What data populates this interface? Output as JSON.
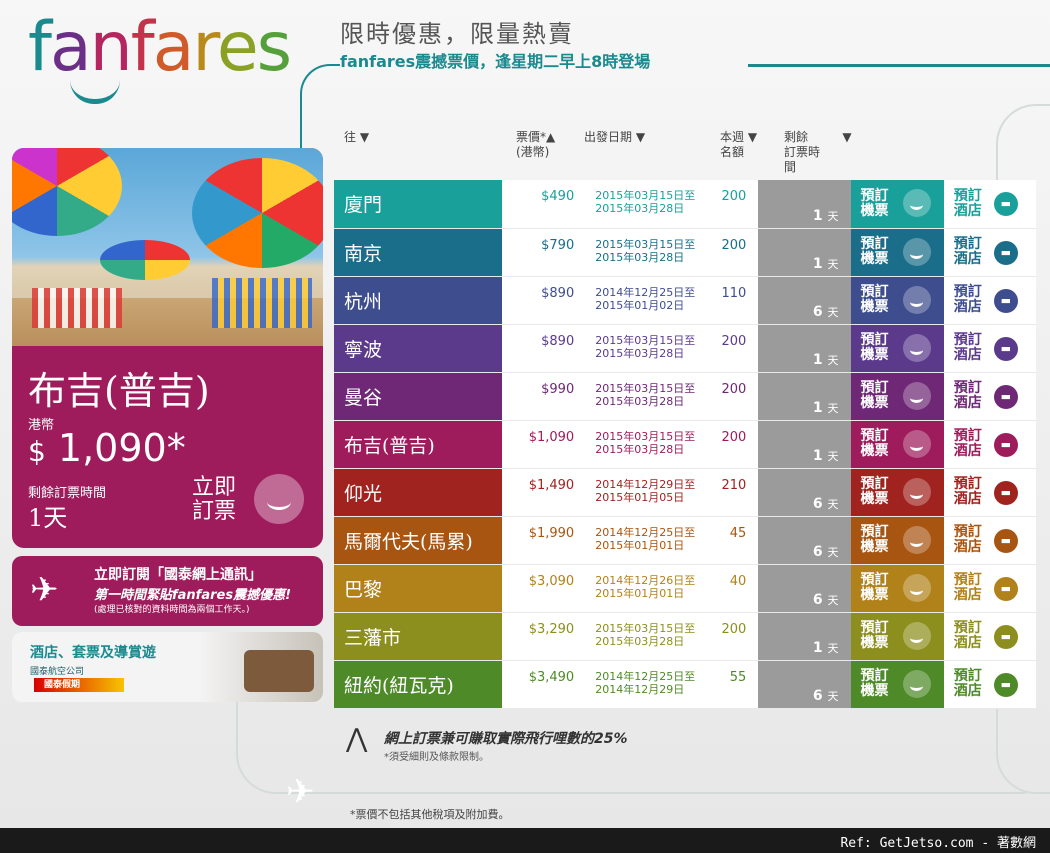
{
  "brand": {
    "logo_text": "fanfares",
    "tag1": "限時優惠，限量熱賣",
    "tag2": "fanfares震撼票價，逢星期二早上8時登場"
  },
  "hero": {
    "city": "布吉(普吉)",
    "currency": "港幣",
    "price_symbol": "$",
    "price": "1,090",
    "star": "*",
    "remaining_label": "剩餘訂票時間",
    "remaining": "1天",
    "book_label_1": "立即",
    "book_label_2": "訂票"
  },
  "subscribe": {
    "line1": "立即訂閱「國泰網上通訊」",
    "line2": "第一時間緊貼fanfares震撼優惠!",
    "line3": "(處理已核對的資料時間為兩個工作天。)"
  },
  "hotel_promo": {
    "title": "酒店、套票及導賞遊",
    "airline": "國泰航空公司",
    "holidays": "國泰假期"
  },
  "columns": {
    "dest": "往",
    "price": "票價*",
    "price_unit": "(港幣)",
    "date": "出發日期",
    "quota_1": "本週",
    "quota_2": "名額",
    "remain_1": "剩餘",
    "remain_2": "訂票時",
    "remain_3": "間",
    "sort_down": "▼",
    "sort_up": "▲"
  },
  "buttons": {
    "flight_1": "預訂",
    "flight_2": "機票",
    "hotel_1": "預訂",
    "hotel_2": "酒店",
    "day_unit": "天"
  },
  "fares": [
    {
      "city": "廈門",
      "price": "$490",
      "date_from": "2015年03月15日至",
      "date_to": "2015年03月28日",
      "quota": "200",
      "days": "1",
      "color": "#1aa09a"
    },
    {
      "city": "南京",
      "price": "$790",
      "date_from": "2015年03月15日至",
      "date_to": "2015年03月28日",
      "quota": "200",
      "days": "1",
      "color": "#1a6e8a"
    },
    {
      "city": "杭州",
      "price": "$890",
      "date_from": "2014年12月25日至",
      "date_to": "2015年01月02日",
      "quota": "110",
      "days": "6",
      "color": "#3e4d8e"
    },
    {
      "city": "寧波",
      "price": "$890",
      "date_from": "2015年03月15日至",
      "date_to": "2015年03月28日",
      "quota": "200",
      "days": "1",
      "color": "#5b3a8c"
    },
    {
      "city": "曼谷",
      "price": "$990",
      "date_from": "2015年03月15日至",
      "date_to": "2015年03月28日",
      "quota": "200",
      "days": "1",
      "color": "#6e2875"
    },
    {
      "city": "布吉(普吉)",
      "price": "$1,090",
      "date_from": "2015年03月15日至",
      "date_to": "2015年03月28日",
      "quota": "200",
      "days": "1",
      "color": "#9e1c5c"
    },
    {
      "city": "仰光",
      "price": "$1,490",
      "date_from": "2014年12月29日至",
      "date_to": "2015年01月05日",
      "quota": "210",
      "days": "6",
      "color": "#a0231f"
    },
    {
      "city": "馬爾代夫(馬累)",
      "price": "$1,990",
      "date_from": "2014年12月25日至",
      "date_to": "2015年01月01日",
      "quota": "45",
      "days": "6",
      "color": "#a85512"
    },
    {
      "city": "巴黎",
      "price": "$3,090",
      "date_from": "2014年12月26日至",
      "date_to": "2015年01月01日",
      "quota": "40",
      "days": "6",
      "color": "#b1811a"
    },
    {
      "city": "三藩市",
      "price": "$3,290",
      "date_from": "2015年03月15日至",
      "date_to": "2015年03月28日",
      "quota": "200",
      "days": "1",
      "color": "#8c8f1e"
    },
    {
      "city": "紐約(紐瓦克)",
      "price": "$3,490",
      "date_from": "2014年12月25日至",
      "date_to": "2014年12月29日",
      "quota": "55",
      "days": "6",
      "color": "#4e8a28"
    }
  ],
  "miles": {
    "line1": "網上訂票兼可賺取實際飛行哩數的25%",
    "line2": "*須受細則及條款限制。"
  },
  "footnote": "*票價不包括其他稅項及附加費。",
  "ref": "Ref: GetJetso.com - 著數網",
  "icons": [
    "plane-icon",
    "smile-icon",
    "bed-icon",
    "sort-arrow-icon",
    "asia-miles-icon"
  ]
}
